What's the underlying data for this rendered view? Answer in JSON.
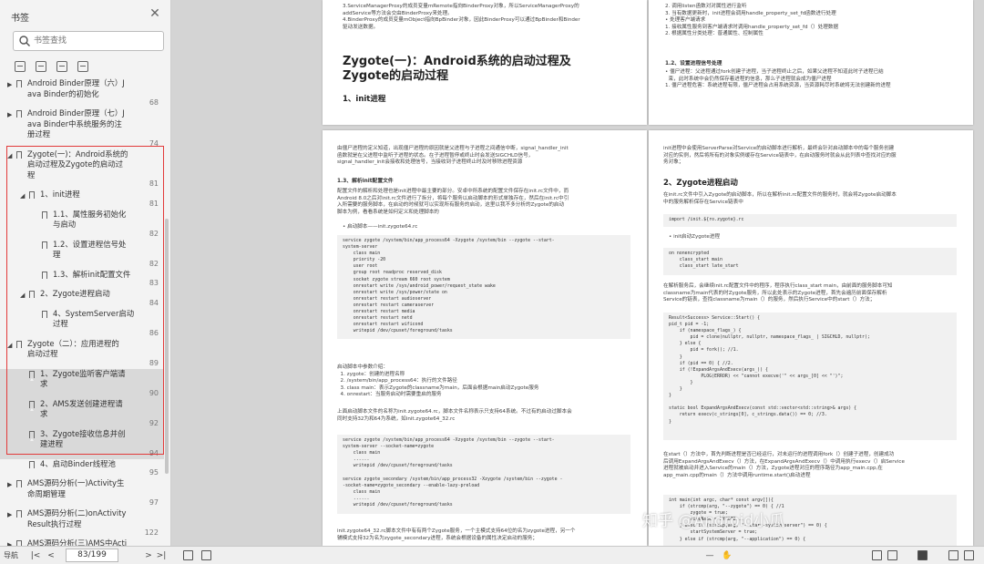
{
  "sidebar": {
    "title": "书签",
    "search_placeholder": "书签查找",
    "toc": [
      {
        "text": "Android Binder原理（六）J\nava Binder的初始化",
        "page": "68",
        "level": 0,
        "caret": "▶"
      },
      {
        "text": "Android Binder原理（七）J\nava Binder中系统服务的注\n册过程",
        "page": "74",
        "level": 0,
        "caret": "▶"
      },
      {
        "text": "Zygote(一)：Android系统的\n启动过程及Zygote的启动过\n程",
        "page": "81",
        "level": 0,
        "caret": "◢"
      },
      {
        "text": "1、init进程",
        "page": "81",
        "level": 1,
        "caret": "◢"
      },
      {
        "text": "1.1、属性服务初始化\n与启动",
        "page": "82",
        "level": 2,
        "caret": ""
      },
      {
        "text": "1.2、设置进程信号处\n理",
        "page": "82",
        "level": 2,
        "caret": ""
      },
      {
        "text": "1.3、解析init配置文件",
        "page": "83",
        "level": 2,
        "caret": ""
      },
      {
        "text": "2、Zygote进程启动",
        "page": "84",
        "level": 1,
        "caret": "◢"
      },
      {
        "text": "4、SystemServer启动\n过程",
        "page": "86",
        "level": 2,
        "caret": ""
      },
      {
        "text": "Zygote（二）：应用进程的\n启动过程",
        "page": "89",
        "level": 0,
        "caret": "◢"
      },
      {
        "text": "1、Zygote监听客户端请\n求",
        "page": "90",
        "level": 1,
        "caret": ""
      },
      {
        "text": "2、AMS发送创建进程请\n求",
        "page": "92",
        "level": 1,
        "caret": ""
      },
      {
        "text": "3、Zygote接收信息并创\n建进程",
        "page": "94",
        "level": 1,
        "caret": ""
      },
      {
        "text": "4、启动Binder线程池",
        "page": "95",
        "level": 1,
        "caret": ""
      },
      {
        "text": "AMS源码分析(一)Activity生\n命周期管理",
        "page": "97",
        "level": 0,
        "caret": "▶"
      },
      {
        "text": "AMS源码分析(二)onActivity\nResult执行过程",
        "page": "122",
        "level": 0,
        "caret": "▶"
      },
      {
        "text": "AMS源码分析(三)AMS中Acti\nvity栈管理详解",
        "page": "127",
        "level": 0,
        "caret": "▶"
      }
    ]
  },
  "document": {
    "p1": {
      "intro": "3.ServiceManagerProxy的成员变量mRemote指向BinderProxy对象，所以ServiceManagerProxy的\naddService等方法会交由BinderProxy来处理。\n4.BinderProxy的成员变量mObject指向BpBinder对象，因此BinderProxy可以通过BpBinder和Binder\n驱动发送数据。",
      "title": "Zygote(一)：Android系统的启动过程及\nZygote的启动过程",
      "sub": "1、init进程"
    },
    "p2": {
      "lines": "2. 调用listen函数对对属性进行监听\n3. 当有数据更新时，init进程会调用handle_property_set_fd函数进行处理\n• 处理客户端请求\n1. 接收属性服务到客户端请求时调用handle_property_set_fd（）处理数据\n2. 根据属性分类处理：普通属性、控制属性",
      "h3": "1.2、设置进程信号处理",
      "lines2": "• 僵尸进程：父进程通过fork创建子进程，当子进程终止之后，如果父进程不知道此时子进程已结\n  束，此时系统中会仍然保存着进程的信息，那么子进程就会成为僵尸进程\n1. 僵尸进程危害：系统进程有限，僵尸进程会占用系统资源，当资源耗尽时系统将无法创建新的进程"
    },
    "p3": {
      "para1": "由僵尸进程的定义知道，出现僵尸进程的原因就是父进程与子进程之间通信中断，signal_handler_init\n函数就是在父进程中监听子进程的状态。在子进程暂停或终止时会发送SIGCHLD信号，\nsignal_handler_init会接收和处理信号，当接收到子进程终止时及时移除进程资源",
      "h3": "1.3、解析init配置文件",
      "para2": "配置文件的解析和处理也是init进程中最主要的部分。安卓中所系统的配置文件保存在init.rc文件中，而\nAndroid 8.0之后对init.rc文件进行了拆分，将每个服务以启动脚本的形式单独存在，然后在init.rc中引\n入所需要的服务脚本，在启动的时候就可以实现所有服务的启动，这里以我不多分析的Zygote的启动\n脚本为例，看看系统是如何定义和处理脚本的",
      "bullet": "• 启动脚本——init.zygote64.rc",
      "code1": "service zygote /system/bin/app_process64 -Xzygote /system/bin --zygote --start-\nsystem-server\n    class main\n    priority -20\n    user root\n    group root readproc reserved_disk\n    socket zygote stream 660 root system\n    onrestart write /sys/android_power/request_state wake\n    onrestart write /sys/power/state on\n    onrestart restart audioserver\n    onrestart restart cameraserver\n    onrestart restart media\n    onrestart restart netd\n    onrestart restart wificond\n    writepid /dev/cpuset/foreground/tasks",
      "para3": "启动脚本中参数介绍：\n  1. zygote：创建的进程名称\n  2. /system/bin/app_process64：执行的文件路径\n  3. class main：表示Zygote的classname为main，后面会根据main启动Zygote服务\n  4. onrestart：当服务启动时需要重启的服务",
      "para4": "上面启动脚本文件的名称为init.zygote64.rc，脚本文件名称表示只支持64系统。不过有的启动过脚本会\n同时支持32为和64为系统，如init.zygote64_32.rc",
      "code2": "service zygote /system/bin/app_process64 -Xzygote /system/bin --zygote --start-\nsystem-server --socket-name=zygote\n    class main\n    ......\n    writepid /dev/cpuset/foreground/tasks\n\nservice zygote_secondary /system/bin/app_process32 -Xzygote /system/bin --zygote -\n-socket-name=zygote_secondary --enable-lazy-preload\n    class main\n    ......\n    writepid /dev/cpuset/foreground/tasks",
      "para5": "init.zygote64_32.rc脚本文件中有有两个Zygote服务，一个主模式支持64位的名为zygote进程，另一个\n辅模式支持32为名为zygote_secondary进程，系统会根据设备的属性决定启动的服务；"
    },
    "p4": {
      "para1": "init进程中会使用ServerParse对Service的启动脚本进行解析，最终会针对启动脚本中的每个服务创建\n对应的实例，然后将所有的对象实例缓存在Service链表中，在启动服务时就会从此列表中查找对应的服\n务对象；",
      "h2": "2、Zygote进程启动",
      "para2": "在init.rc文件中引入Zygote的启动脚本，所以在解析init.rc配置文件的服务时，就会将Zygote启动脚本\n中的服务解析保存在Service链表中",
      "code1": "import /init.${ro.zygote}.rc",
      "bullet": "• init启动Zygote进程",
      "code2": "on nonencrypted\n    class_start main\n    class_start late_start",
      "para3": "在解析服务后，会继续init.rc配置文件中的程序，程序执行class_start main，由前面的服务脚本可知\nclassname为main代表的时Zygote服务，所以此处表示的Zygote进程，首先会遍历前面保存解析\nService的链表，查找classname为main（）的服务，然后执行Service中的start（）方法；",
      "code3": "Result<Success> Service::Start() {\npid_t pid = -1;\n    if (namespace_flags_) {\n        pid = clone(nullptr, nullptr, namespace_flags_ | SIGCHLD, nullptr);\n    } else {\n        pid = fork(); //1.\n    }\n    if (pid == 0) { //2.\n    if (!ExpandArgsAndExecv(args_)) {\n            PLOG(ERROR) << \"cannot execve('\" << args_[0] << \"')\";\n        }\n    }\n}\n\nstatic bool ExpandArgsAndExecv(const std::vector<std::string>& args) {\n    return execv(c_strings[0], c_strings.data()) == 0; //3.\n}",
      "para4": "在start（）方法中，首先判断进程是否已经运行，对未运行的进程调用fork（）创建子进程，创建成功\n后调用ExpandArgsAndExecv（）方法，在ExpandArgsAndExecv（）中调用执行execv（）启Service\n进程就被启动并进入Service的main（）方法，Zygote进程对应的程序路径为app_main.cpp,在\napp_main.cpp的main（）方法中调用runtime.start()启动进程",
      "code4": "int main(int argc, char* const argv[]){\n    if (strcmp(arg, \"--zygote\") == 0) { //1\n        zygote = true;\n        niceName = ZYGOTE...\n    } else if (strcmp(arg, \"--start-system-server\") == 0) {\n        startSystemServer = true;\n    } else if (strcmp(arg, \"--application\") == 0) {"
    },
    "watermark": "知乎 @Android小瓜"
  },
  "bottombar": {
    "nav_label": "导航",
    "page_indicator": "83/199"
  },
  "colors": {
    "highlight_box": "#e23a3a",
    "selected_row": "#d9d9d9"
  }
}
